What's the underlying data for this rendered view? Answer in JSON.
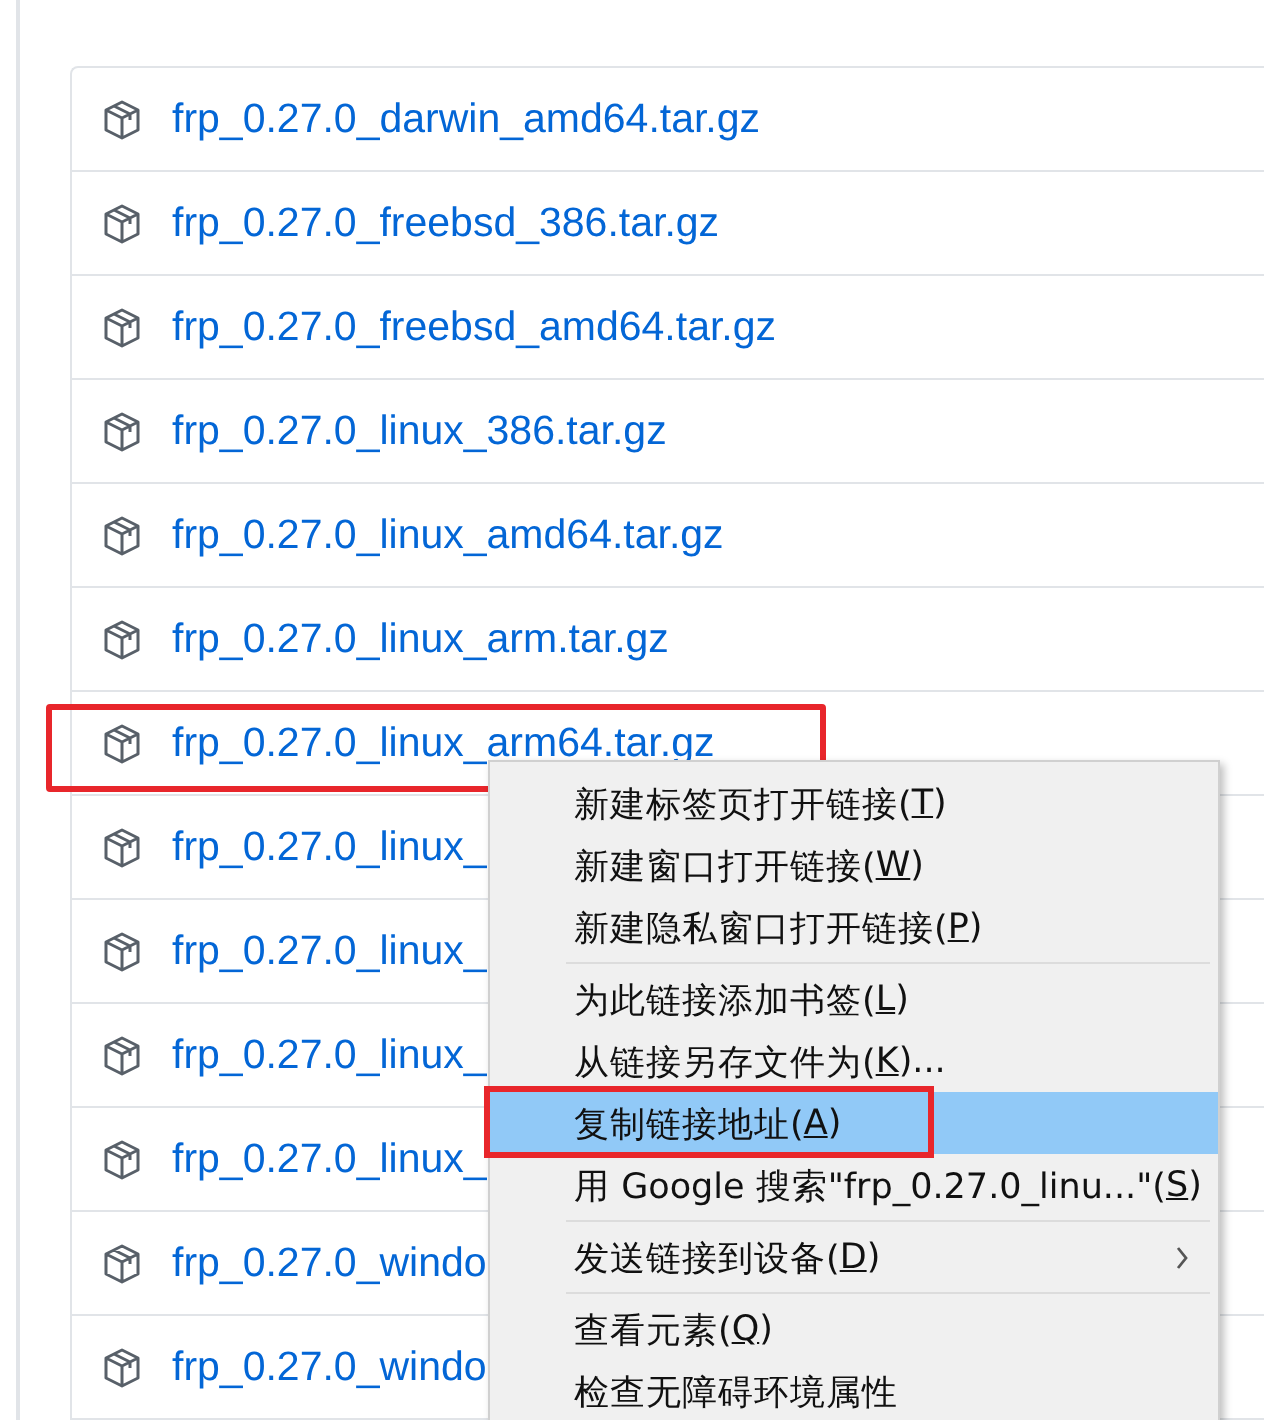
{
  "assets": [
    {
      "name": "frp_0.27.0_darwin_amd64.tar.gz",
      "annotated": false
    },
    {
      "name": "frp_0.27.0_freebsd_386.tar.gz",
      "annotated": false
    },
    {
      "name": "frp_0.27.0_freebsd_amd64.tar.gz",
      "annotated": false
    },
    {
      "name": "frp_0.27.0_linux_386.tar.gz",
      "annotated": false
    },
    {
      "name": "frp_0.27.0_linux_amd64.tar.gz",
      "annotated": false
    },
    {
      "name": "frp_0.27.0_linux_arm.tar.gz",
      "annotated": false
    },
    {
      "name": "frp_0.27.0_linux_arm64.tar.gz",
      "annotated": true
    },
    {
      "name": "frp_0.27.0_linux_",
      "annotated": false
    },
    {
      "name": "frp_0.27.0_linux_",
      "annotated": false
    },
    {
      "name": "frp_0.27.0_linux_",
      "annotated": false
    },
    {
      "name": "frp_0.27.0_linux_",
      "annotated": false
    },
    {
      "name": "frp_0.27.0_windo",
      "annotated": false
    },
    {
      "name": "frp_0.27.0_windo",
      "annotated": false
    }
  ],
  "context_menu": {
    "items": [
      {
        "kind": "item",
        "label": "新建标签页打开链接(",
        "key": "T",
        "after": ")",
        "selected": false,
        "annotated": false,
        "has_submenu": false
      },
      {
        "kind": "item",
        "label": "新建窗口打开链接(",
        "key": "W",
        "after": ")",
        "selected": false,
        "annotated": false,
        "has_submenu": false
      },
      {
        "kind": "item",
        "label": "新建隐私窗口打开链接(",
        "key": "P",
        "after": ")",
        "selected": false,
        "annotated": false,
        "has_submenu": false
      },
      {
        "kind": "separator"
      },
      {
        "kind": "item",
        "label": "为此链接添加书签(",
        "key": "L",
        "after": ")",
        "selected": false,
        "annotated": false,
        "has_submenu": false
      },
      {
        "kind": "item",
        "label": "从链接另存文件为(",
        "key": "K",
        "after": ")...",
        "selected": false,
        "annotated": false,
        "has_submenu": false
      },
      {
        "kind": "item",
        "label": "复制链接地址(",
        "key": "A",
        "after": ")",
        "selected": true,
        "annotated": true,
        "has_submenu": false
      },
      {
        "kind": "item",
        "label": "用 Google 搜索\"frp_0.27.0_linu...\"(",
        "key": "S",
        "after": ")",
        "selected": false,
        "annotated": false,
        "has_submenu": false
      },
      {
        "kind": "separator"
      },
      {
        "kind": "item",
        "label": "发送链接到设备(",
        "key": "D",
        "after": ")",
        "selected": false,
        "annotated": false,
        "has_submenu": true
      },
      {
        "kind": "separator"
      },
      {
        "kind": "item",
        "label": "查看元素(",
        "key": "Q",
        "after": ")",
        "selected": false,
        "annotated": false,
        "has_submenu": false
      },
      {
        "kind": "item",
        "label": "检查无障碍环境属性",
        "selected": false,
        "annotated": false,
        "has_submenu": false
      }
    ]
  }
}
